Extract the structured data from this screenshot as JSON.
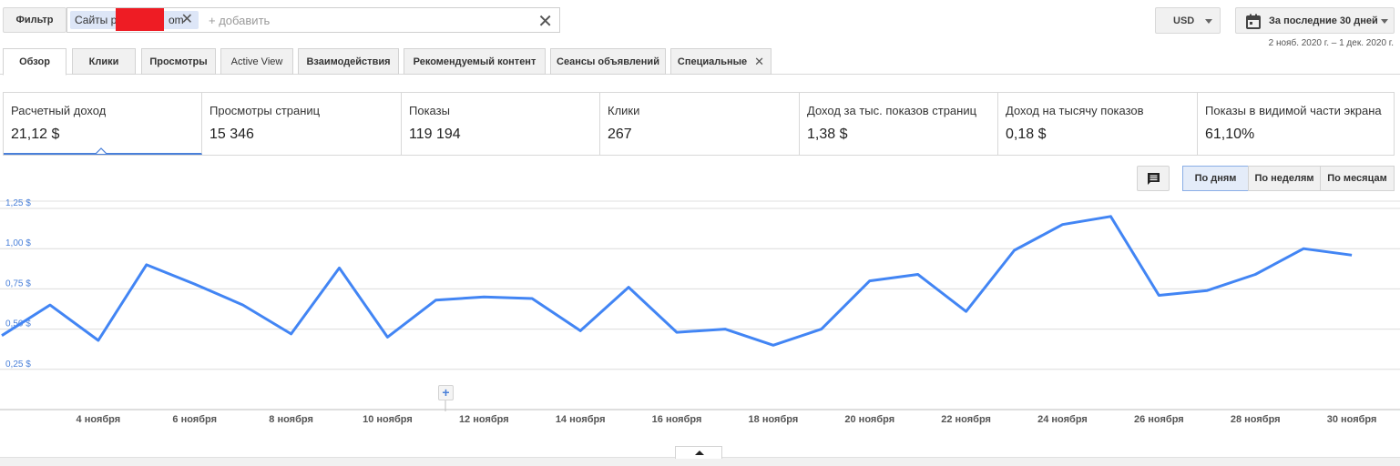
{
  "filter": {
    "button_label": "Фильтр",
    "chip_label": "Сайты p",
    "chip_suffix": "om",
    "add_placeholder": "+ добавить"
  },
  "currency": {
    "label": "USD"
  },
  "period": {
    "label": "За последние 30 дней",
    "date_range": "2 нояб. 2020 г. – 1 дек. 2020 г."
  },
  "tabs": [
    {
      "label": "Обзор"
    },
    {
      "label": "Клики"
    },
    {
      "label": "Просмотры"
    },
    {
      "label": "Active View"
    },
    {
      "label": "Взаимодействия"
    },
    {
      "label": "Рекомендуемый контент"
    },
    {
      "label": "Сеансы объявлений"
    },
    {
      "label": "Специальные"
    }
  ],
  "metrics": [
    {
      "label": "Расчетный доход",
      "value": "21,12 $"
    },
    {
      "label": "Просмотры страниц",
      "value": "15 346"
    },
    {
      "label": "Показы",
      "value": "119 194"
    },
    {
      "label": "Клики",
      "value": "267"
    },
    {
      "label": "Доход за тыс. показов страниц",
      "value": "1,38 $"
    },
    {
      "label": "Доход на тысячу показов",
      "value": "0,18 $"
    },
    {
      "label": "Показы в видимой части экрана",
      "value": "61,10%"
    }
  ],
  "granularity": {
    "options": [
      "По дням",
      "По неделям",
      "По месяцам"
    ],
    "selected": "По дням"
  },
  "colors": {
    "accent": "#4a80d9",
    "line": "#4285f4"
  },
  "chart_data": {
    "type": "line",
    "x": [
      "2 ноября",
      "3 ноября",
      "4 ноября",
      "5 ноября",
      "6 ноября",
      "7 ноября",
      "8 ноября",
      "9 ноября",
      "10 ноября",
      "11 ноября",
      "12 ноября",
      "13 ноября",
      "14 ноября",
      "15 ноября",
      "16 ноября",
      "17 ноября",
      "18 ноября",
      "19 ноября",
      "20 ноября",
      "21 ноября",
      "22 ноября",
      "23 ноября",
      "24 ноября",
      "25 ноября",
      "26 ноября",
      "27 ноября",
      "28 ноября",
      "29 ноября",
      "30 ноября",
      "1 декабря"
    ],
    "series": [
      {
        "values": [
          0.46,
          0.65,
          0.43,
          0.9,
          0.78,
          0.65,
          0.47,
          0.88,
          0.45,
          0.68,
          0.7,
          0.69,
          0.49,
          0.76,
          0.48,
          0.5,
          0.4,
          0.5,
          0.8,
          0.84,
          0.61,
          0.99,
          1.15,
          1.2,
          0.71,
          0.74,
          0.84,
          1.0,
          0.96
        ]
      }
    ],
    "x_tick_labels": [
      "4 ноября",
      "6 ноября",
      "8 ноября",
      "10 ноября",
      "12 ноября",
      "14 ноября",
      "16 ноября",
      "18 ноября",
      "20 ноября",
      "22 ноября",
      "24 ноября",
      "26 ноября",
      "28 ноября",
      "30 ноября"
    ],
    "y_tick_labels": [
      "0,25 $",
      "0,50 $",
      "0,75 $",
      "1,00 $",
      "1,25 $"
    ],
    "y_ticks": [
      0.25,
      0.5,
      0.75,
      1.0,
      1.25
    ],
    "ylim": [
      0,
      1.25
    ],
    "grid": true
  }
}
